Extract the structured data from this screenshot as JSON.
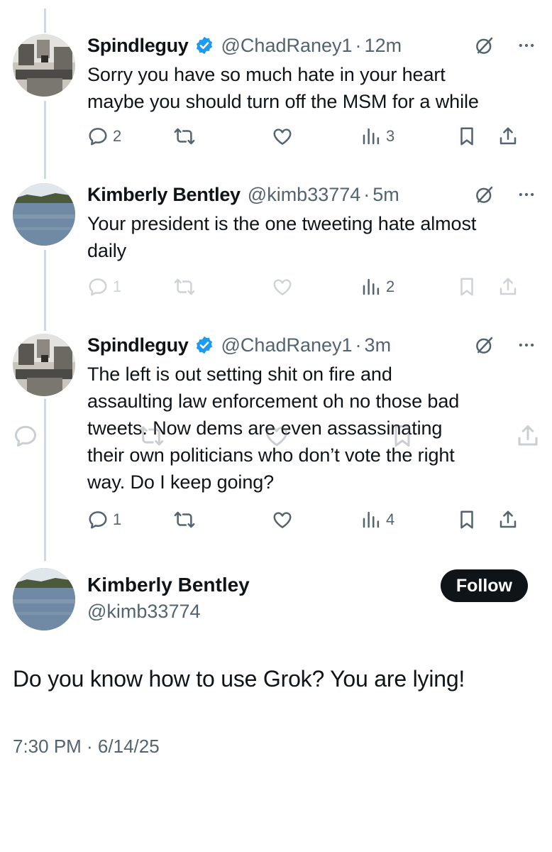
{
  "tweets": [
    {
      "name": "Spindleguy",
      "verified": true,
      "handle": "@ChadRaney1",
      "time": "12m",
      "text_lines": [
        "Sorry you have so much hate in your heart",
        "maybe you should turn off the MSM for a while"
      ],
      "replies": "2",
      "views": "3",
      "dimmed": false
    },
    {
      "name": "Kimberly Bentley",
      "verified": false,
      "handle": "@kimb33774",
      "time": "5m",
      "text_lines": [
        "Your president is the one tweeting hate almost",
        "daily"
      ],
      "replies": "1",
      "views": "2",
      "dimmed": true
    },
    {
      "name": "Spindleguy",
      "verified": true,
      "handle": "@ChadRaney1",
      "time": "3m",
      "text_lines": [
        "The left is out setting shit on fire and",
        "assaulting law enforcement oh no those bad",
        "tweets.  Now dems are even assassinating",
        "their own politicians who don’t vote the right",
        "way.  Do I keep going?"
      ],
      "replies": "1",
      "views": "4",
      "dimmed": false
    }
  ],
  "main": {
    "name": "Kimberly Bentley",
    "handle": "@kimb33774",
    "follow_label": "Follow",
    "text": "Do you know how to use Grok? You are lying!",
    "timestamp": "7:30 PM · 6/14/25"
  },
  "dot": "·",
  "colors": {
    "text": "#0f1419",
    "secondary": "#536471",
    "verified": "#1d9bf0",
    "thread_line": "#cfd9de"
  },
  "icons": [
    "reply-icon",
    "retweet-icon",
    "like-icon",
    "views-icon",
    "bookmark-icon",
    "share-icon",
    "grok-icon",
    "more-icon",
    "verified-badge-icon"
  ]
}
